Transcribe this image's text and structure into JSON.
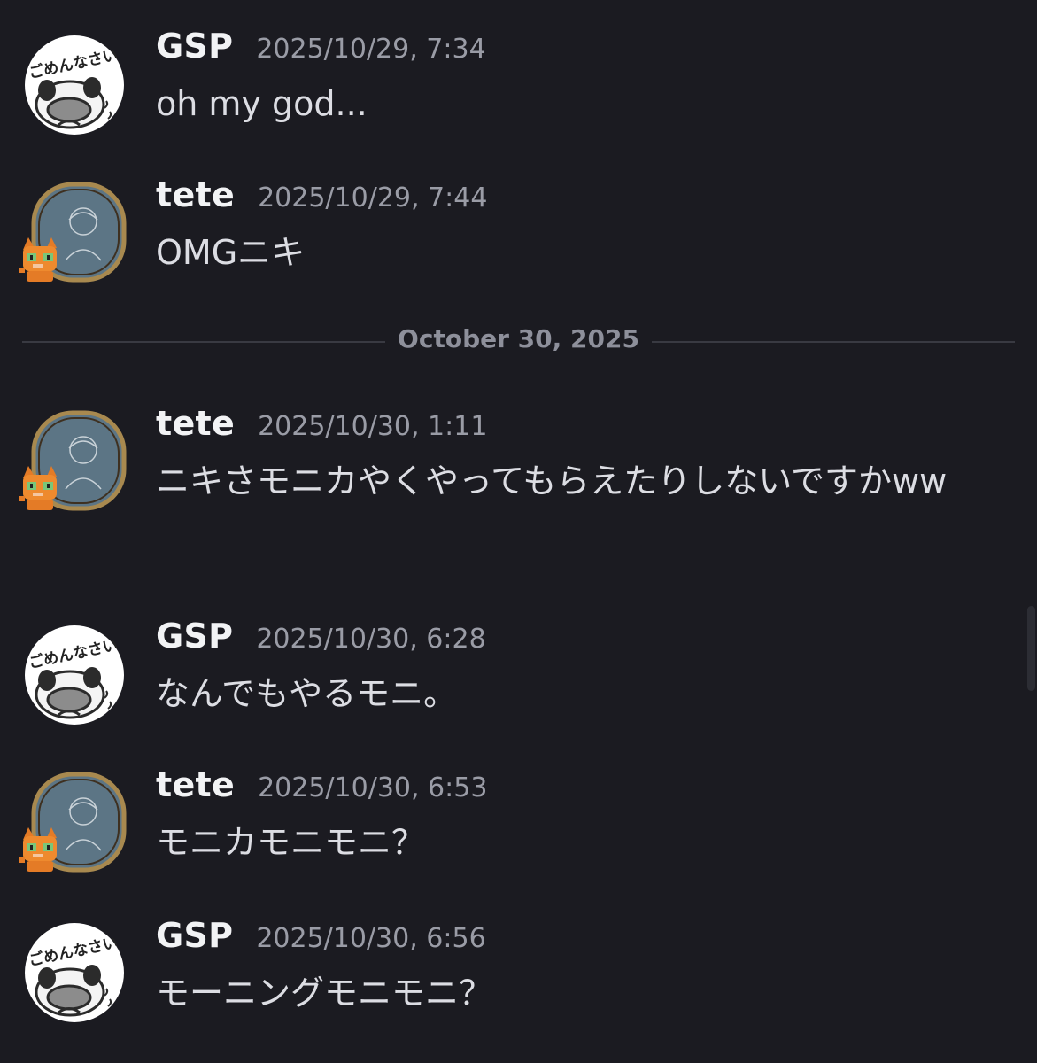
{
  "app": {
    "accent_color": "#1b1b21",
    "text_color": "#dcdde3",
    "timestamp_color": "#9a9ca6"
  },
  "date_divider": {
    "label": "October 30, 2025"
  },
  "avatars": {
    "gsp": {
      "icon": "panda-sticker-avatar",
      "text": "ごめんなさい"
    },
    "tete": {
      "icon": "pixel-frame-portrait-avatar",
      "decoration": "orange-cat-icon"
    }
  },
  "messages": [
    {
      "author": "GSP",
      "timestamp": "2025/10/29, 7:34",
      "text": "oh my god...",
      "avatar": "gsp"
    },
    {
      "author": "tete",
      "timestamp": "2025/10/29, 7:44",
      "text": "OMGニキ",
      "avatar": "tete"
    },
    {
      "author": "tete",
      "timestamp": "2025/10/30, 1:11",
      "text": "ニキさモニカやくやってもらえたりしないですかww",
      "avatar": "tete"
    },
    {
      "author": "GSP",
      "timestamp": "2025/10/30, 6:28",
      "text": "なんでもやるモニ。",
      "avatar": "gsp"
    },
    {
      "author": "tete",
      "timestamp": "2025/10/30, 6:53",
      "text": "モニカモニモニ？",
      "avatar": "tete"
    },
    {
      "author": "GSP",
      "timestamp": "2025/10/30, 6:56",
      "text": "モーニングモニモニ？",
      "avatar": "gsp"
    }
  ]
}
